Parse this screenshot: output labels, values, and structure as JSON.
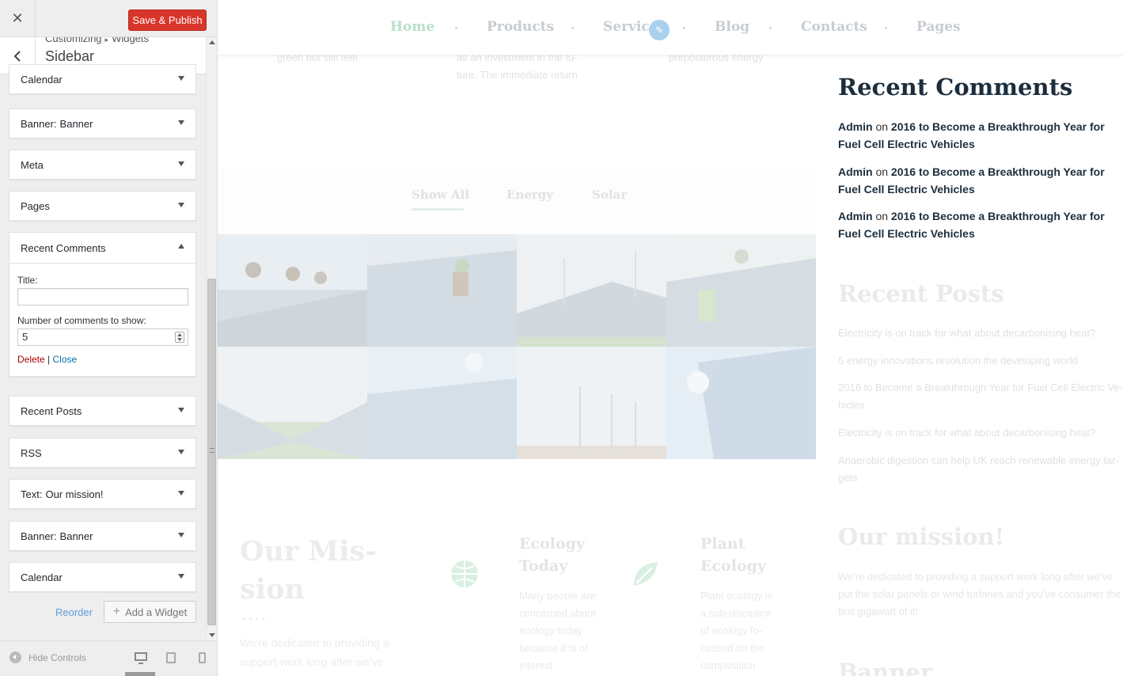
{
  "customizer": {
    "close_symbol": "✕",
    "publish_label": "Save & Publish",
    "breadcrumb": [
      "Customizing",
      "Widgets"
    ],
    "breadcrumb_sep": "▸",
    "section_title": "Sidebar",
    "widgets": [
      {
        "title": "Calendar",
        "subtitle": "",
        "expanded": false
      },
      {
        "title": "Banner:",
        "subtitle": "Banner",
        "expanded": false
      },
      {
        "title": "Meta",
        "subtitle": "",
        "expanded": false
      },
      {
        "title": "Pages",
        "subtitle": "",
        "expanded": false
      },
      {
        "title": "Recent Comments",
        "subtitle": "",
        "expanded": true
      },
      {
        "title": "Recent Posts",
        "subtitle": "",
        "expanded": false
      },
      {
        "title": "RSS",
        "subtitle": "",
        "expanded": false
      },
      {
        "title": "Text:",
        "subtitle": "Our mission!",
        "expanded": false
      },
      {
        "title": "Banner:",
        "subtitle": "Banner",
        "expanded": false
      },
      {
        "title": "Calendar",
        "subtitle": "",
        "expanded": false
      }
    ],
    "form": {
      "title_label": "Title:",
      "title_value": "",
      "count_label": "Number of comments to show:",
      "count_value": "5",
      "delete_label": "Delete",
      "divider": "|",
      "close_label": "Close"
    },
    "reorder_label": "Reorder",
    "add_widget_label": "Add a Widget",
    "hide_controls_label": "Hide Controls"
  },
  "preview": {
    "nav": [
      "Home",
      "Products",
      "Service",
      "Blog",
      "Contacts",
      "Pages"
    ],
    "above_text": [
      [
        "green but still feel"
      ],
      [
        "as an investment in the fu-",
        "ture. The immediate return"
      ],
      [
        "preposterous energy"
      ]
    ],
    "filters": [
      "Show All",
      "Energy",
      "Solar"
    ],
    "recent_comments": {
      "title": "Recent Comments",
      "items": [
        {
          "author": "Admin",
          "on": "on",
          "post": "2016 to Become a Breakthrough Year for Fuel Cell Electric Vehicles"
        },
        {
          "author": "Admin",
          "on": "on",
          "post": "2016 to Become a Breakthrough Year for Fuel Cell Electric Vehicles"
        },
        {
          "author": "Admin",
          "on": "on",
          "post": "2016 to Become a Breakthrough Year for Fuel Cell Electric Vehicles"
        }
      ]
    },
    "recent_posts": {
      "title": "Recent Posts",
      "items": [
        "Electricity is on track for what about decarbonising heat?",
        "5 energy innovations revolution the developing world",
        "2016 to Become a Breakthrough Year for Fuel Cell Electric Ve-hicles",
        "Electricity is on track for what about decarbonising heat?",
        "Anaerobic digestion can help UK reach renewable energy tar-gets"
      ]
    },
    "mission": {
      "title": "Our Mis-sion",
      "dots": "....",
      "body": "We're dedicated to providing a support work long after we've",
      "side_title": "Our mission!",
      "side_body": "We're dedicated to providing a support work long after we've put the solar panels or wind turbines and you've consumer the first gigawatt of it!"
    },
    "columns": [
      {
        "title": "Ecology Today",
        "body": "Many people are concerned about ecology today because it is of interest"
      },
      {
        "title": "Plant Ecology",
        "body": "Plant ecology is a sub-discipline of ecology fo-cussed on the composition"
      }
    ],
    "banner_title": "Banner"
  },
  "colors": {
    "publish": "#d9362b",
    "nav_active": "#b7e0ca",
    "heading": "#1c2e3d",
    "link": "#0073aa",
    "delete": "#aa0000"
  }
}
